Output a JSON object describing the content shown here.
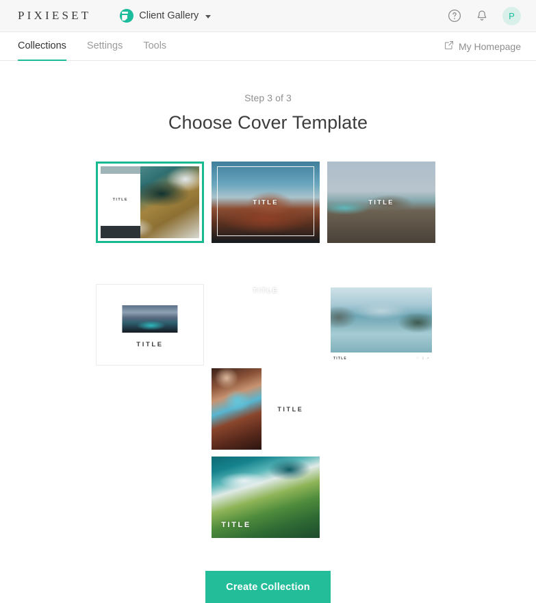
{
  "topbar": {
    "brand": "PIXIESET",
    "workspace_name": "Client Gallery",
    "workspace_icon": "pixieset-logo-icon",
    "caret_icon": "chevron-down-icon",
    "help_icon": "help-circle-icon",
    "notifications_icon": "bell-icon",
    "avatar_initial": "P",
    "accent_color": "#1abc9c"
  },
  "nav": {
    "tabs": [
      {
        "label": "Collections",
        "active": true
      },
      {
        "label": "Settings",
        "active": false
      },
      {
        "label": "Tools",
        "active": false
      }
    ],
    "homepage_label": "My Homepage",
    "homepage_icon": "external-link-icon",
    "active_underline_color": "#1abc9c"
  },
  "main": {
    "step_label": "Step 3 of 3",
    "title": "Choose Cover Template"
  },
  "templates": [
    {
      "id": "template-1",
      "title_text": "TITLE",
      "selected": true,
      "layout": "panel-left-aerial-coast"
    },
    {
      "id": "template-2",
      "title_text": "TITLE",
      "selected": false,
      "layout": "framed-center-mesa"
    },
    {
      "id": "template-3",
      "title_text": "TITLE",
      "selected": false,
      "layout": "full-center-arch"
    },
    {
      "id": "template-4",
      "title_text": "TITLE",
      "selected": false,
      "layout": "matte-center-seascape"
    },
    {
      "id": "template-5",
      "title_text": "TITLE",
      "selected": false,
      "layout": "white-card-below-title"
    },
    {
      "id": "template-6",
      "title_text": "TITLE",
      "selected": false,
      "layout": "split-canyon-right-title"
    },
    {
      "id": "template-7",
      "title_text": "TITLE",
      "selected": false,
      "layout": "lake-bottom-bar-title"
    },
    {
      "id": "template-8",
      "title_text": "TITLE",
      "selected": false,
      "layout": "tropical-bottom-left-title"
    }
  ],
  "footer": {
    "create_label": "Create Collection",
    "button_color": "#23bd9a"
  }
}
